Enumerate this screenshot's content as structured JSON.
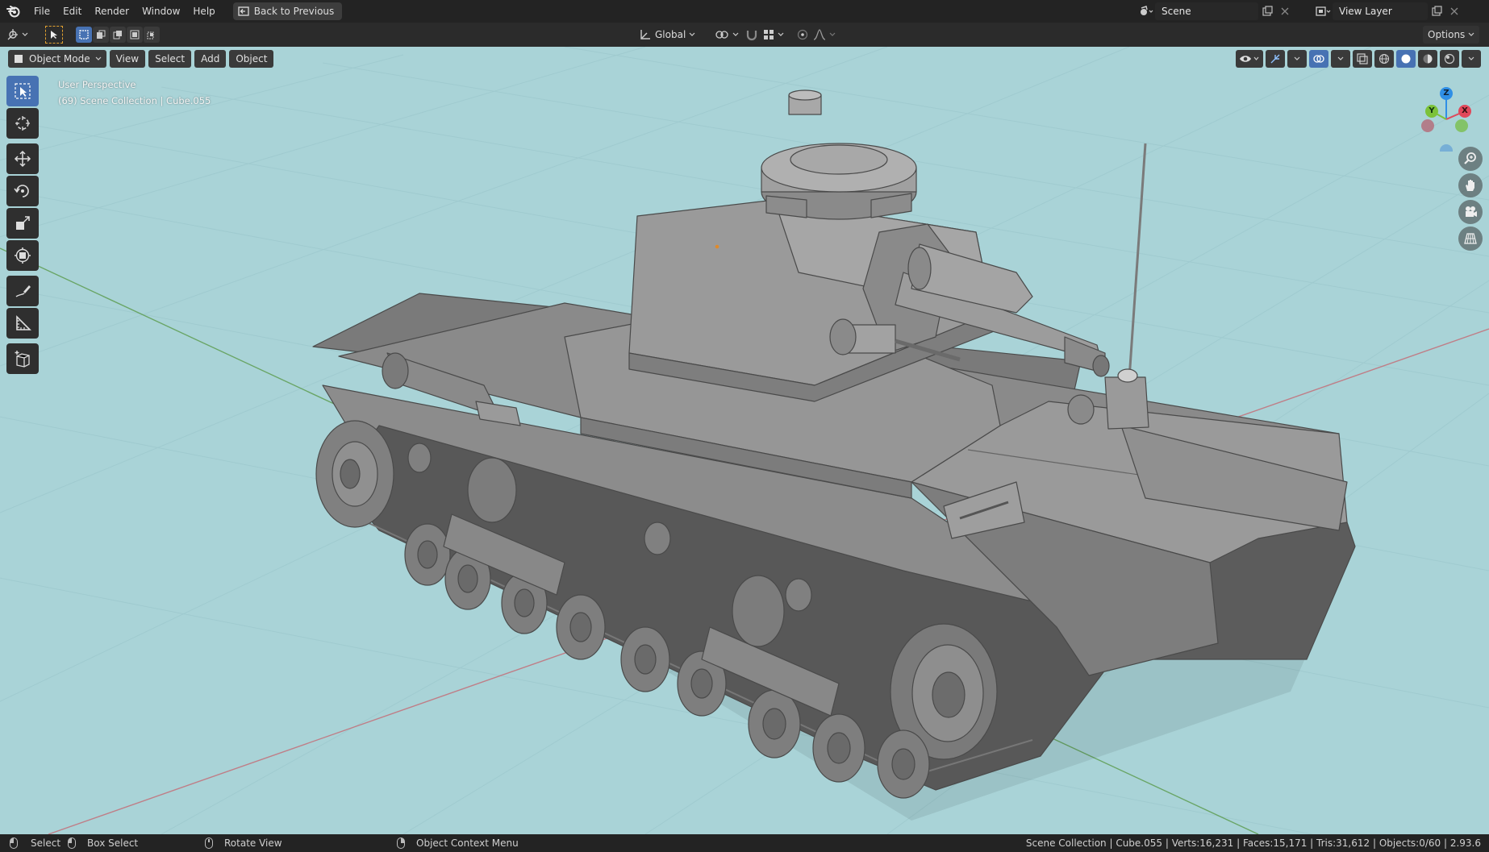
{
  "menubar": {
    "items": [
      "File",
      "Edit",
      "Render",
      "Window",
      "Help"
    ],
    "back_button": "Back to Previous",
    "scene": "Scene",
    "view_layer": "View Layer"
  },
  "header": {
    "orientation": "Global",
    "options": "Options"
  },
  "viewport": {
    "mode": "Object Mode",
    "menus": [
      "View",
      "Select",
      "Add",
      "Object"
    ],
    "view_name": "User Perspective",
    "collection_info": "(69) Scene Collection | Cube.055",
    "background_color": "#a9d3d7"
  },
  "gizmo": {
    "x": "X",
    "y": "Y",
    "z": "Z"
  },
  "statusbar": {
    "select": "Select",
    "box_select": "Box Select",
    "rotate_view": "Rotate View",
    "context_menu": "Object Context Menu",
    "stats": "Scene Collection | Cube.055 | Verts:16,231 | Faces:15,171 | Tris:31,612 | Objects:0/60 | 2.93.6"
  },
  "colors": {
    "accent": "#4772b3",
    "axis_x": "#e0485a",
    "axis_y": "#7cc23a",
    "axis_z": "#2f8fe6"
  }
}
